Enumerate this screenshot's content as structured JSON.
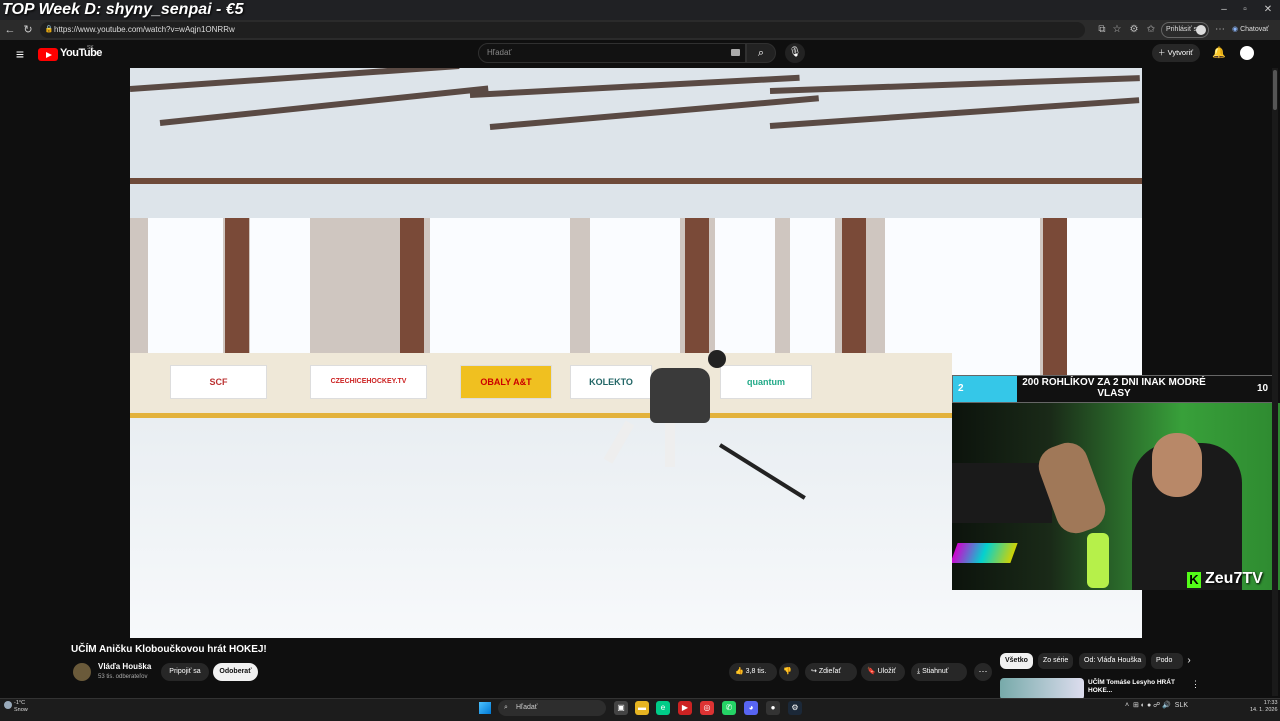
{
  "stream_overlay": {
    "tab_title": "TOP Week D: shyny_senpai - €5",
    "goal_start": "2",
    "goal_text": "200 ROHLÍKOV ZA 2 DNI INAK MODRÉ VLASY",
    "goal_end": "10",
    "goal_progress": 0.2,
    "channel_name": "Zeu7TV",
    "kick_icon": "K"
  },
  "browser": {
    "url": "https://www.youtube.com/watch?v=wAqjn1ONRRw",
    "signin_label": "Prihlásiť sa",
    "chat_label": "Chatovať",
    "icons": [
      "back-icon",
      "reload-icon",
      "lock-icon",
      "tab-icon",
      "star-icon",
      "extension-icon",
      "favorites-icon",
      "collections-icon",
      "more-icon"
    ]
  },
  "youtube": {
    "logo_text": "YouTube",
    "country_code": "SK",
    "search_placeholder": "Hľadať",
    "create_label": "Vytvoriť",
    "brand_color": "#ff0000"
  },
  "video": {
    "title": "UČÍM Aničku Kloboučkovou hrát HOKEJ!",
    "ads": [
      "SCF",
      "CZECHICEHOCKEY.TV",
      "OBALY A&T",
      "KOLEKTO",
      "quantum"
    ]
  },
  "channel": {
    "name": "Vláďa Houška",
    "subscribers": "53 tis. odberateľov",
    "join_label": "Pripojiť sa",
    "subscribe_label": "Odoberať"
  },
  "actions": {
    "likes": "3,8 tis.",
    "share": "Zdieľať",
    "save": "Uložiť",
    "download": "Stiahnuť"
  },
  "recommendations": {
    "chips": [
      "Všetko",
      "Zo série",
      "Od: Vláďa Houška",
      "Podo"
    ],
    "first_title": "UČÍM Tomáše Lesyho HRÁT HOKE..."
  },
  "taskbar": {
    "temperature": "-1°C",
    "weather": "Snow",
    "search_label": "Hľadať",
    "language": "SLK",
    "time": "17:33",
    "date": "14. 1. 2026"
  }
}
